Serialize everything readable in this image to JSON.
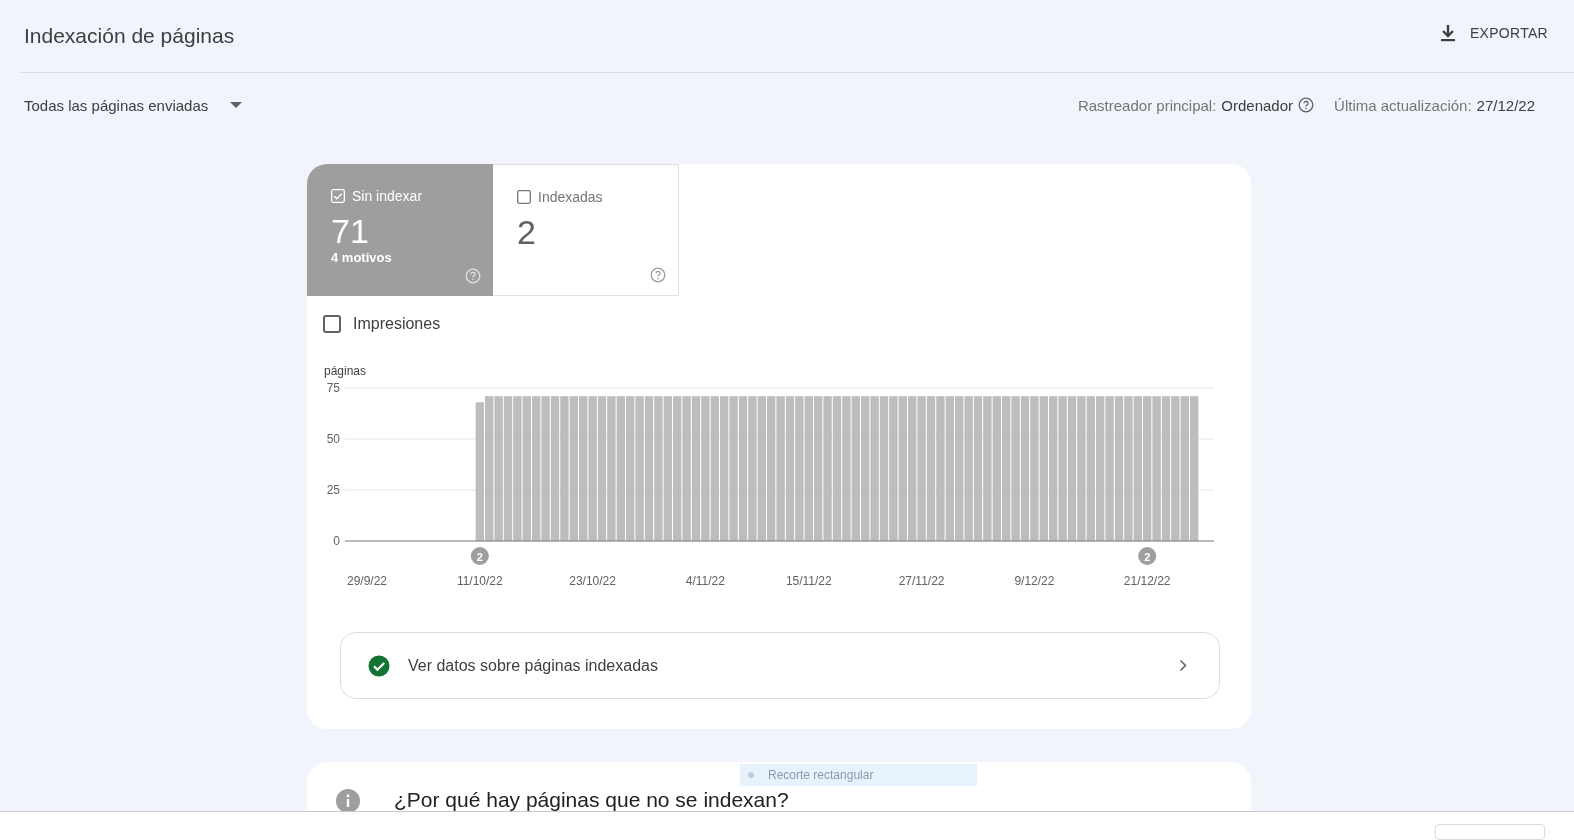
{
  "header": {
    "title": "Indexación de páginas",
    "export_label": "EXPORTAR"
  },
  "filter": {
    "label": "Todas las páginas enviadas"
  },
  "meta": [
    {
      "label": "Rastreador principal:",
      "value": "Ordenador",
      "help": true
    },
    {
      "label": "Última actualización:",
      "value": "27/12/22"
    }
  ],
  "summary_tabs": [
    {
      "label": "Sin indexar",
      "value": "71",
      "note": "4 motivos",
      "selected": true
    },
    {
      "label": "Indexadas",
      "value": "2",
      "selected": false
    }
  ],
  "impressions": {
    "label": "Impresiones",
    "checked": false
  },
  "chart_data": {
    "type": "bar",
    "ylabel": "páginas",
    "color": "#bdbdbd",
    "categories": [
      "29/9/22",
      null,
      null,
      null,
      null,
      null,
      null,
      null,
      null,
      null,
      null,
      null,
      "11/10/22",
      null,
      null,
      null,
      null,
      null,
      null,
      null,
      null,
      null,
      null,
      null,
      "23/10/22",
      null,
      null,
      null,
      null,
      null,
      null,
      null,
      null,
      null,
      null,
      null,
      "4/11/22",
      null,
      null,
      null,
      null,
      null,
      null,
      null,
      null,
      null,
      null,
      "15/11/22",
      null,
      null,
      null,
      null,
      null,
      null,
      null,
      null,
      null,
      null,
      null,
      "27/11/22",
      null,
      null,
      null,
      null,
      null,
      null,
      null,
      null,
      null,
      null,
      null,
      "9/12/22",
      null,
      null,
      null,
      null,
      null,
      null,
      null,
      null,
      null,
      null,
      null,
      "21/12/22",
      null,
      null,
      null,
      null,
      null
    ],
    "values": [
      0,
      0,
      0,
      0,
      0,
      0,
      0,
      0,
      0,
      0,
      0,
      0,
      68,
      71,
      71,
      71,
      71,
      71,
      71,
      71,
      71,
      71,
      71,
      71,
      71,
      71,
      71,
      71,
      71,
      71,
      71,
      71,
      71,
      71,
      71,
      71,
      71,
      71,
      71,
      71,
      71,
      71,
      71,
      71,
      71,
      71,
      71,
      71,
      71,
      71,
      71,
      71,
      71,
      71,
      71,
      71,
      71,
      71,
      71,
      71,
      71,
      71,
      71,
      71,
      71,
      71,
      71,
      71,
      71,
      71,
      71,
      71,
      71,
      71,
      71,
      71,
      71,
      71,
      71,
      71,
      71,
      71,
      71,
      71,
      71,
      71,
      71,
      71,
      71
    ],
    "ylim": [
      0,
      75
    ],
    "yticks": [
      0,
      25,
      50,
      75
    ],
    "annotations": [
      "2",
      "2"
    ]
  },
  "indexed_link": {
    "label": "Ver datos sobre páginas indexadas"
  },
  "reasons_card": {
    "title": "¿Por qué hay páginas que no se indexan?"
  },
  "snipping_toast": {
    "text": "Recorte rectangular"
  },
  "download_bar": {
    "kind": "downloads"
  }
}
